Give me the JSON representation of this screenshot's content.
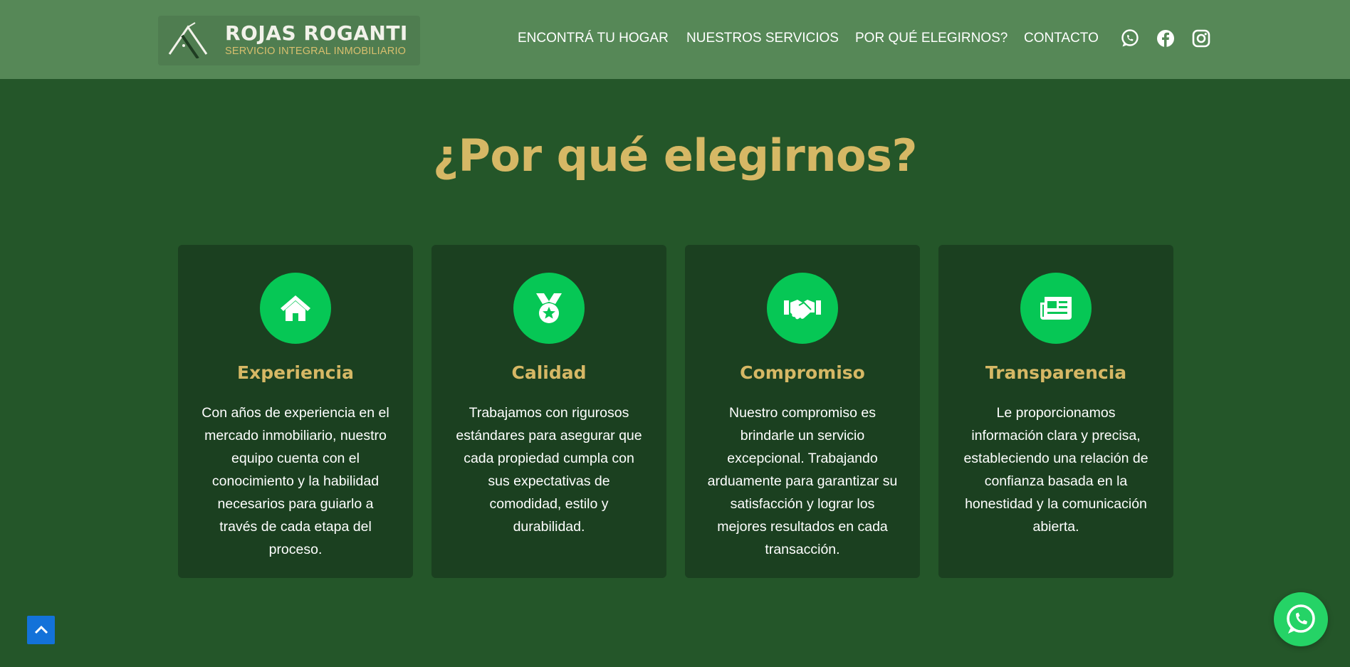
{
  "header": {
    "logo": {
      "title": "ROJAS ROGANTI",
      "subtitle": "SERVICIO INTEGRAL INMOBILIARIO"
    },
    "nav": [
      {
        "label": "ENCONTRÁ TU HOGAR"
      },
      {
        "label": "NUESTROS SERVICIOS"
      },
      {
        "label": "POR QUÉ ELEGIRNOS?"
      },
      {
        "label": "CONTACTO"
      }
    ],
    "social_icons": [
      "whatsapp-icon",
      "facebook-icon",
      "instagram-icon"
    ]
  },
  "section": {
    "title": "¿Por qué elegirnos?",
    "cards": [
      {
        "icon": "home-icon",
        "title": "Experiencia",
        "text": "Con años de experiencia en el mercado inmobiliario, nuestro equipo cuenta con el conocimiento y la habilidad necesarios para guiarlo a través de cada etapa del proceso."
      },
      {
        "icon": "medal-icon",
        "title": "Calidad",
        "text": "Trabajamos con rigurosos estándares para asegurar que cada propiedad cumpla con sus expectativas de comodidad, estilo y durabilidad."
      },
      {
        "icon": "handshake-icon",
        "title": "Compromiso",
        "text": "Nuestro compromiso es brindarle un servicio excepcional. Trabajando arduamente para garantizar su satisfacción y lograr los mejores resultados en cada transacción."
      },
      {
        "icon": "newspaper-icon",
        "title": "Transparencia",
        "text": "Le proporcionamos información clara y precisa, estableciendo una relación de confianza basada en la honestidad y la comunicación abierta."
      }
    ]
  },
  "floating": {
    "back_to_top_icon": "chevron-up-icon",
    "whatsapp_icon": "whatsapp-icon"
  },
  "colors": {
    "header_bg": "#568857",
    "page_bg": "#245629",
    "card_bg": "#1b4020",
    "accent_gold": "#d6b865",
    "icon_green": "#06c755",
    "back_to_top": "#1372d9",
    "whatsapp": "#25d366"
  }
}
